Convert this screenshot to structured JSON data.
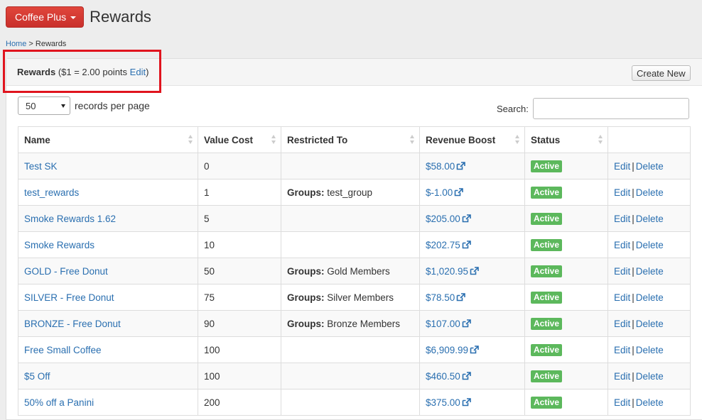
{
  "header": {
    "brand_label": "Coffee Plus",
    "page_title": "Rewards"
  },
  "breadcrumb": {
    "home": "Home",
    "separator": ">",
    "current": "Rewards"
  },
  "panel": {
    "title_bold": "Rewards",
    "title_rate": "($1 = 2.00 points",
    "title_edit": "Edit",
    "title_close": ")",
    "create_label": "Create New"
  },
  "controls": {
    "per_page_value": "50",
    "per_page_label": "records per page",
    "search_label": "Search:"
  },
  "table": {
    "columns": [
      "Name",
      "Value Cost",
      "Restricted To",
      "Revenue Boost",
      "Status",
      ""
    ],
    "edit_label": "Edit",
    "delete_label": "Delete",
    "rows": [
      {
        "name": "Test SK",
        "cost": "0",
        "restricted_label": "",
        "restricted_value": "",
        "boost": "$58.00",
        "status": "Active"
      },
      {
        "name": "test_rewards",
        "cost": "1",
        "restricted_label": "Groups:",
        "restricted_value": "test_group",
        "boost": "$-1.00",
        "status": "Active"
      },
      {
        "name": "Smoke Rewards 1.62",
        "cost": "5",
        "restricted_label": "",
        "restricted_value": "",
        "boost": "$205.00",
        "status": "Active"
      },
      {
        "name": "Smoke Rewards",
        "cost": "10",
        "restricted_label": "",
        "restricted_value": "",
        "boost": "$202.75",
        "status": "Active"
      },
      {
        "name": "GOLD - Free Donut",
        "cost": "50",
        "restricted_label": "Groups:",
        "restricted_value": "Gold Members",
        "boost": "$1,020.95",
        "status": "Active"
      },
      {
        "name": "SILVER - Free Donut",
        "cost": "75",
        "restricted_label": "Groups:",
        "restricted_value": "Silver Members",
        "boost": "$78.50",
        "status": "Active"
      },
      {
        "name": "BRONZE - Free Donut",
        "cost": "90",
        "restricted_label": "Groups:",
        "restricted_value": "Bronze Members",
        "boost": "$107.00",
        "status": "Active"
      },
      {
        "name": "Free Small Coffee",
        "cost": "100",
        "restricted_label": "",
        "restricted_value": "",
        "boost": "$6,909.99",
        "status": "Active"
      },
      {
        "name": "$5 Off",
        "cost": "100",
        "restricted_label": "",
        "restricted_value": "",
        "boost": "$460.50",
        "status": "Active"
      },
      {
        "name": "50% off a Panini",
        "cost": "200",
        "restricted_label": "",
        "restricted_value": "",
        "boost": "$375.00",
        "status": "Active"
      }
    ]
  },
  "colors": {
    "brand": "#d9362c",
    "link": "#2a6fb0",
    "active_badge": "#5cb85c",
    "highlight": "#e0141e"
  },
  "icons": {
    "brand_caret": "caret-down-icon",
    "external_link": "external-link-icon",
    "sort": "sort-icon",
    "select_arrow": "chevron-down-icon"
  }
}
